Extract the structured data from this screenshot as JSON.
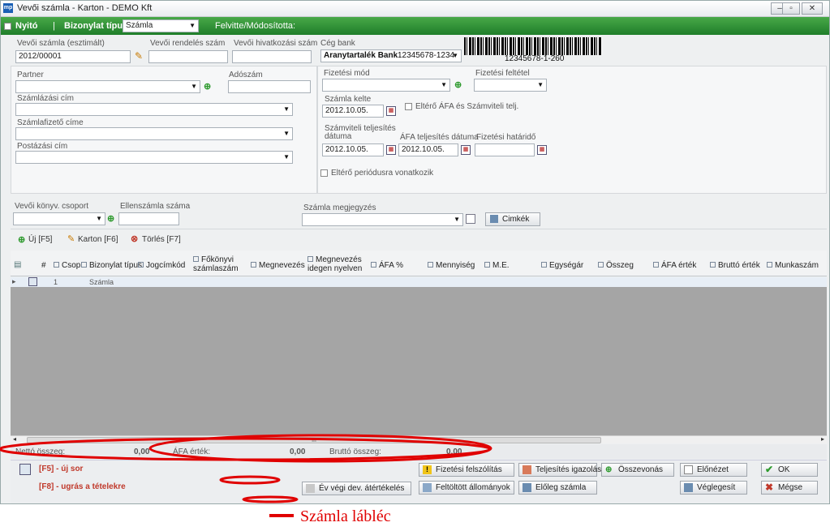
{
  "window": {
    "app_logo": "mp",
    "title": "Vevői számla - Karton - DEMO Kft"
  },
  "greenbar": {
    "opening_label": "Nyitó",
    "doc_type_label": "Bizonylat típus",
    "doc_type_value": "Számla",
    "created_by_label": "Felvitte/Módosította:"
  },
  "header": {
    "invoice_no_label": "Vevői számla (esztimált)",
    "invoice_no_value": "2012/00001",
    "order_no_label": "Vevői rendelés szám",
    "ref_no_label": "Vevői hivatkozási szám",
    "bank_label": "Cég bank",
    "bank_name": "Aranytartalék Bank",
    "bank_account": "12345678-1234",
    "barcode_text": "12345678-1-260"
  },
  "partner": {
    "partner_label": "Partner",
    "tax_label": "Adószám",
    "billing_label": "Számlázási cím",
    "payer_label": "Számlafizető címe",
    "postal_label": "Postázási  cím"
  },
  "payment": {
    "method_label": "Fizetési mód",
    "condition_label": "Fizetési feltétel",
    "issue_label": "Számla kelte",
    "issue_date": "2012.10.05.",
    "diff_vat_label": "Eltérő ÁFA és Számviteli telj.",
    "acc_label": "Számviteli teljesítés dátuma",
    "acc_date": "2012.10.05.",
    "vat_label": "ÁFA teljesítés dátuma",
    "vat_date": "2012.10.05.",
    "due_label": "Fizetési határidő",
    "period_label": "Eltérő periódusra vonatkozik"
  },
  "middle": {
    "group_label": "Vevői könyv. csoport",
    "counter_label": "Ellenszámla száma",
    "note_label": "Számla megjegyzés",
    "tags_button": "Cimkék"
  },
  "toolbar": {
    "new": "Új  [F5]",
    "card": "Karton  [F6]",
    "delete": "Törlés  [F7]"
  },
  "grid": {
    "columns": [
      "#",
      "Csop",
      "Bizonylat típus",
      "Jogcímkód",
      "Főkönyvi számlaszám",
      "Megnevezés",
      "Megnevezés idegen nyelven",
      "ÁFA %",
      "Mennyiség",
      "M.E.",
      "Egységár",
      "Összeg",
      "ÁFA érték",
      "Bruttó érték",
      "Munkaszám"
    ],
    "rows": [
      {
        "num": "1",
        "type": "Számla"
      }
    ],
    "scroll_mark": "III"
  },
  "summary": {
    "net_label": "Nettó összeg:",
    "net_value": "0,00",
    "vat_label": "ÁFA érték:",
    "vat_value": "0,00",
    "gross_label": "Bruttó összeg:",
    "gross_value": "0,00"
  },
  "footer": {
    "hint_new": "[F5] - új sor",
    "hint_jump": "[F8] - ugrás a tételekre",
    "btn_yearend": "Év végi dev. átértékelés",
    "btn_reminder": "Fizetési felszólítás",
    "btn_completion": "Teljesítés igazolás",
    "btn_merge": "Összevonás",
    "btn_preview": "Előnézet",
    "btn_ok": "OK",
    "btn_uploaded": "Feltöltött állományok",
    "btn_advance": "Előleg számla",
    "btn_finalize": "Véglegesít",
    "btn_cancel": "Mégse"
  },
  "annotation": {
    "text": "Számla lábléc",
    "color": "#e00000"
  }
}
